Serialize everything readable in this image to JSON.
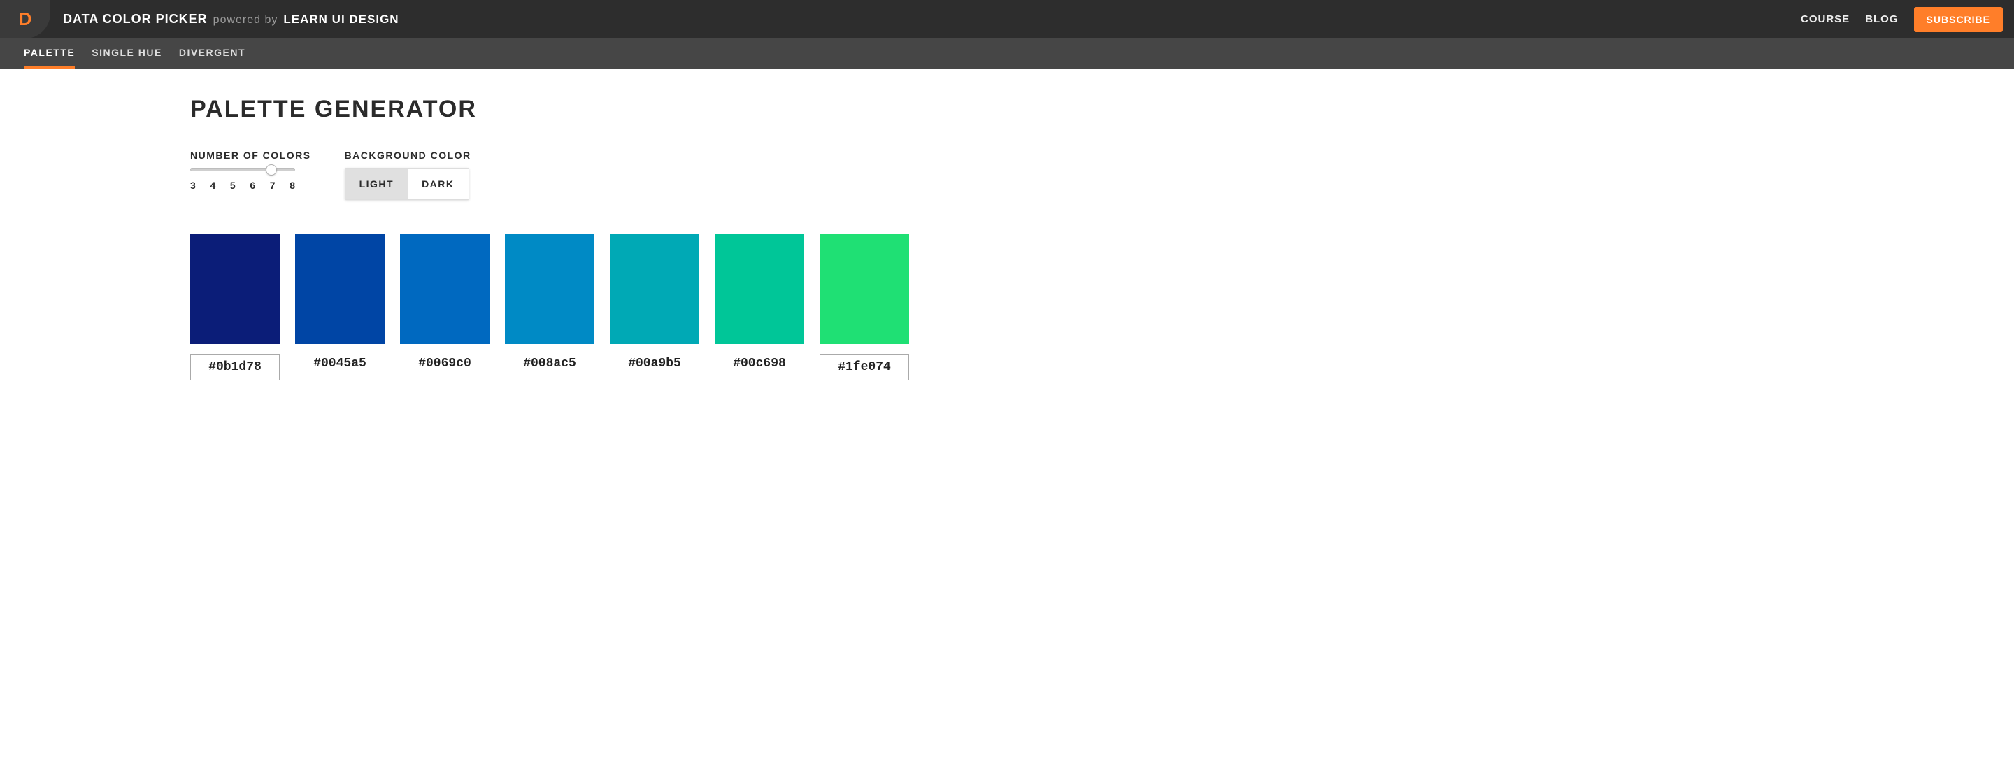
{
  "header": {
    "logo_letter": "D",
    "app_title": "DATA COLOR PICKER",
    "powered_by": "powered by",
    "brand": "LEARN UI DESIGN",
    "links": {
      "course": "COURSE",
      "blog": "BLOG"
    },
    "subscribe": "SUBSCRIBE"
  },
  "tabs": {
    "palette": {
      "label": "PALETTE",
      "active": true
    },
    "single_hue": {
      "label": "SINGLE HUE",
      "active": false
    },
    "divergent": {
      "label": "DIVERGENT",
      "active": false
    }
  },
  "page": {
    "title": "PALETTE GENERATOR",
    "num_colors_label": "NUMBER OF COLORS",
    "num_colors_scale": [
      "3",
      "4",
      "5",
      "6",
      "7",
      "8"
    ],
    "num_colors_value": 7,
    "bg_label": "BACKGROUND COLOR",
    "bg_light": "LIGHT",
    "bg_dark": "DARK",
    "bg_selected": "LIGHT"
  },
  "palette": [
    {
      "hex": "#0b1d78",
      "editable": true
    },
    {
      "hex": "#0045a5",
      "editable": false
    },
    {
      "hex": "#0069c0",
      "editable": false
    },
    {
      "hex": "#008ac5",
      "editable": false
    },
    {
      "hex": "#00a9b5",
      "editable": false
    },
    {
      "hex": "#00c698",
      "editable": false
    },
    {
      "hex": "#1fe074",
      "editable": true
    }
  ]
}
